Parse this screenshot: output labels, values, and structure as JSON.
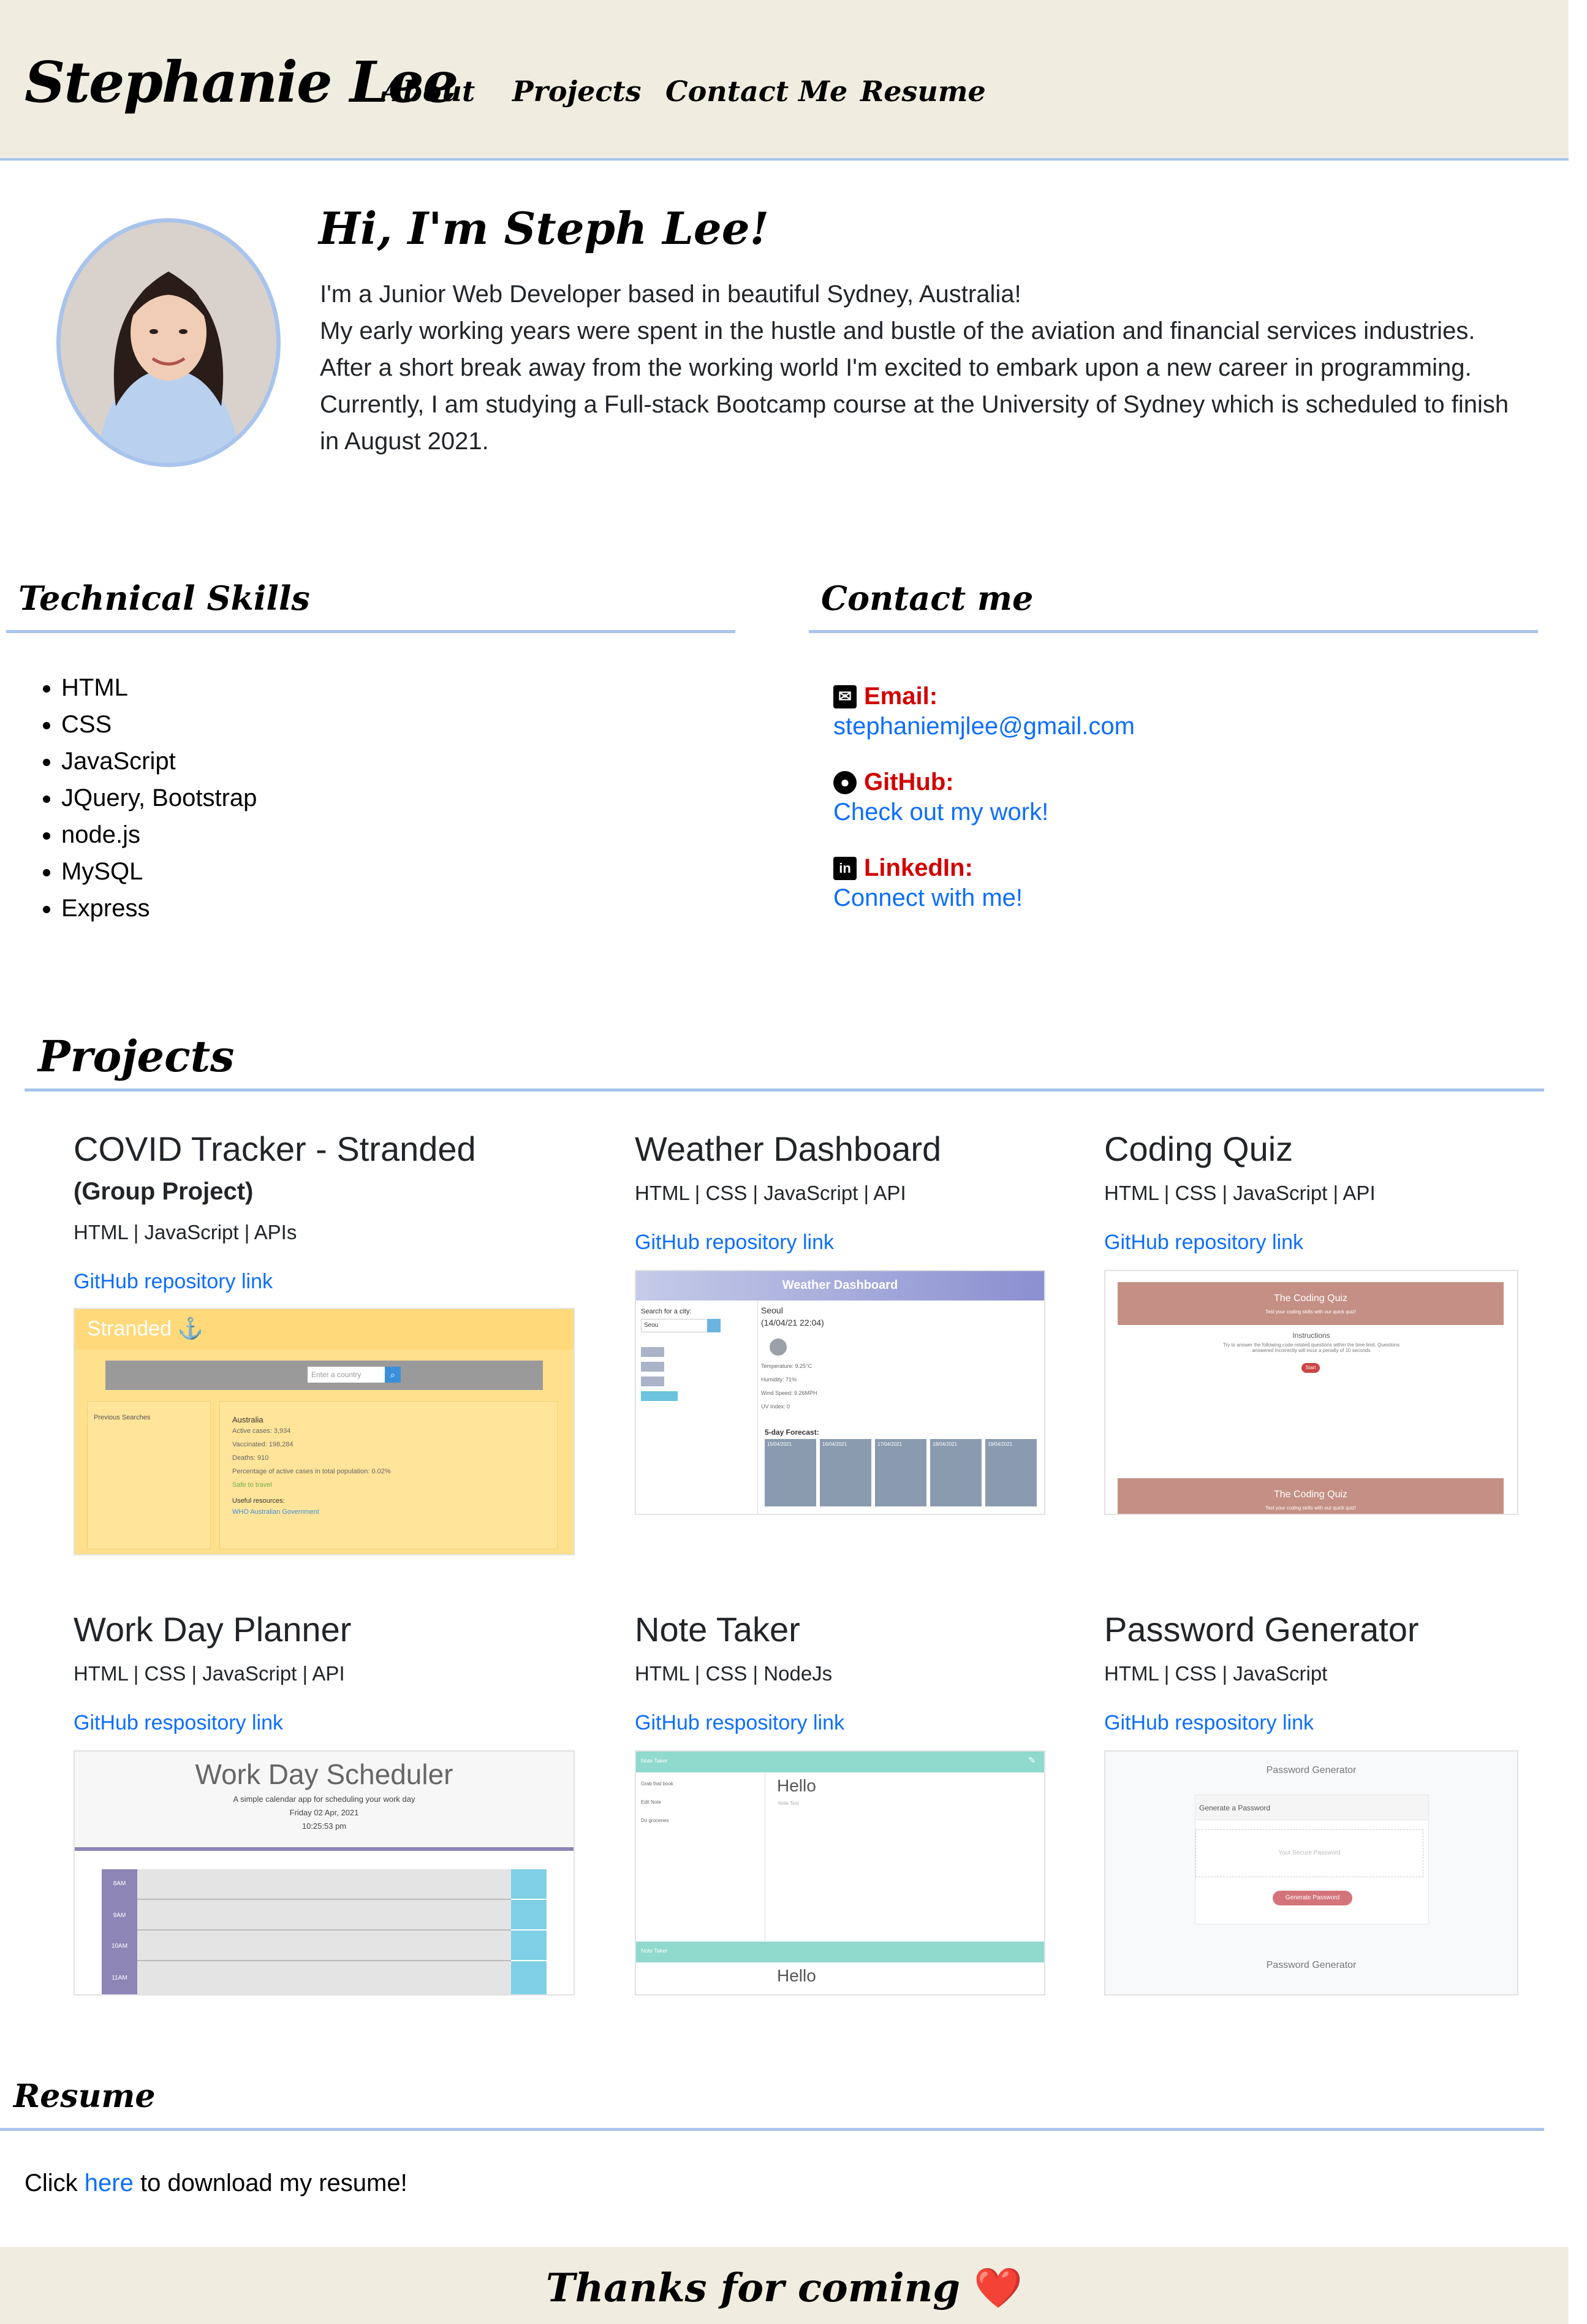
{
  "header": {
    "brand": "Stephanie Lee",
    "nav": [
      "About",
      "Projects",
      "Contact Me",
      "Resume"
    ]
  },
  "intro": {
    "greeting": "Hi, I'm Steph Lee!",
    "bio": [
      "I'm a Junior Web Developer based in beautiful Sydney, Australia!",
      "My early working years were spent in the hustle and bustle of the aviation and financial services industries.",
      "After a short break away from the working world I'm excited to embark upon a new career in programming.",
      "Currently, I am studying a Full-stack Bootcamp course at the University of Sydney which is scheduled to finish in August 2021."
    ]
  },
  "skills": {
    "title": "Technical Skills",
    "items": [
      "HTML",
      "CSS",
      "JavaScript",
      "JQuery, Bootstrap",
      "node.js",
      "MySQL",
      "Express"
    ]
  },
  "contact": {
    "title": "Contact me",
    "email_label": "Email:",
    "email_value": "stephaniemjlee@gmail.com",
    "github_label": "GitHub:",
    "github_value": "Check out my work!",
    "linkedin_label": "LinkedIn:",
    "linkedin_value": "Connect with me!"
  },
  "projects": {
    "title": "Projects",
    "items": [
      {
        "name": "COVID Tracker - Stranded",
        "subtitle": "(Group Project)",
        "tech": "HTML | JavaScript | APIs",
        "link": "GitHub repository link"
      },
      {
        "name": "Weather Dashboard",
        "tech": "HTML | CSS | JavaScript | API",
        "link": "GitHub repository link"
      },
      {
        "name": "Coding Quiz",
        "tech": "HTML | CSS | JavaScript | API",
        "link": "GitHub repository link"
      },
      {
        "name": "Work Day Planner",
        "tech": "HTML | CSS | JavaScript | API",
        "link": "GitHub respository link"
      },
      {
        "name": "Note Taker",
        "tech": "HTML | CSS | NodeJs",
        "link": "GitHub respository link"
      },
      {
        "name": "Password Generator",
        "tech": "HTML | CSS | JavaScript",
        "link": "GitHub respository link"
      }
    ],
    "screens": {
      "stranded_title": "Stranded ⚓",
      "stranded_search": "Enter a country",
      "stranded_prev": "Previous Searches",
      "stranded_country": "Australia",
      "stranded_lines": [
        "Active cases: 3,934",
        "Vaccinated: 198,284",
        "Deaths: 910",
        "Percentage of active cases in total population: 0.02%",
        "Safe to travel",
        "Useful resources:",
        "WHO      Australian Government"
      ],
      "weather_title": "Weather Dashboard",
      "weather_search_label": "Search for a city:",
      "weather_search_value": "Seou",
      "weather_city": "Seoul",
      "weather_date": "(14/04/21 22:04)",
      "weather_lines": [
        "Temperature: 9.25°C",
        "Humidity: 71%",
        "Wind Speed: 9.26MPH",
        "UV Index: 0"
      ],
      "weather_forecast_title": "5-day Forecast:",
      "weather_forecast_days": [
        "15/04/2021",
        "16/04/2021",
        "17/04/2021",
        "18/04/2021",
        "19/04/2021"
      ],
      "quiz_title": "The Coding Quiz",
      "quiz_sub": "Test your coding skills with our quick quiz!",
      "quiz_instructions": "Instructions",
      "quiz_text": "Try to answer the following code-related questions within the time limit. Questions answered incorrectly will incur a penalty of 10 seconds",
      "quiz_start": "Start",
      "planner_title": "Work Day Scheduler",
      "planner_sub": "A simple calendar app for scheduling your work day",
      "planner_date": "Friday 02 Apr, 2021",
      "planner_time": "10:25:53 pm",
      "planner_hours": [
        "8AM",
        "9AM",
        "10AM",
        "11AM"
      ],
      "note_title": "Note Taker",
      "note_items": [
        "Grab that book",
        "Edit Note",
        "Do groceries"
      ],
      "note_hello": "Hello",
      "note_text": "Note Text",
      "pw_title": "Password Generator",
      "pw_gen": "Generate a Password",
      "pw_placeholder": "Your Secure Password",
      "pw_button": "Generate Password"
    }
  },
  "resume": {
    "title": "Resume",
    "text_before": "Click ",
    "link": "here",
    "text_after": " to download my resume!"
  },
  "footer": {
    "text": "Thanks for coming",
    "heart": "❤️"
  },
  "colors": {
    "header_bg": "#f0ede0",
    "rule": "#a9c4ec",
    "link": "#0d6efd",
    "contact_label": "#d20000"
  }
}
